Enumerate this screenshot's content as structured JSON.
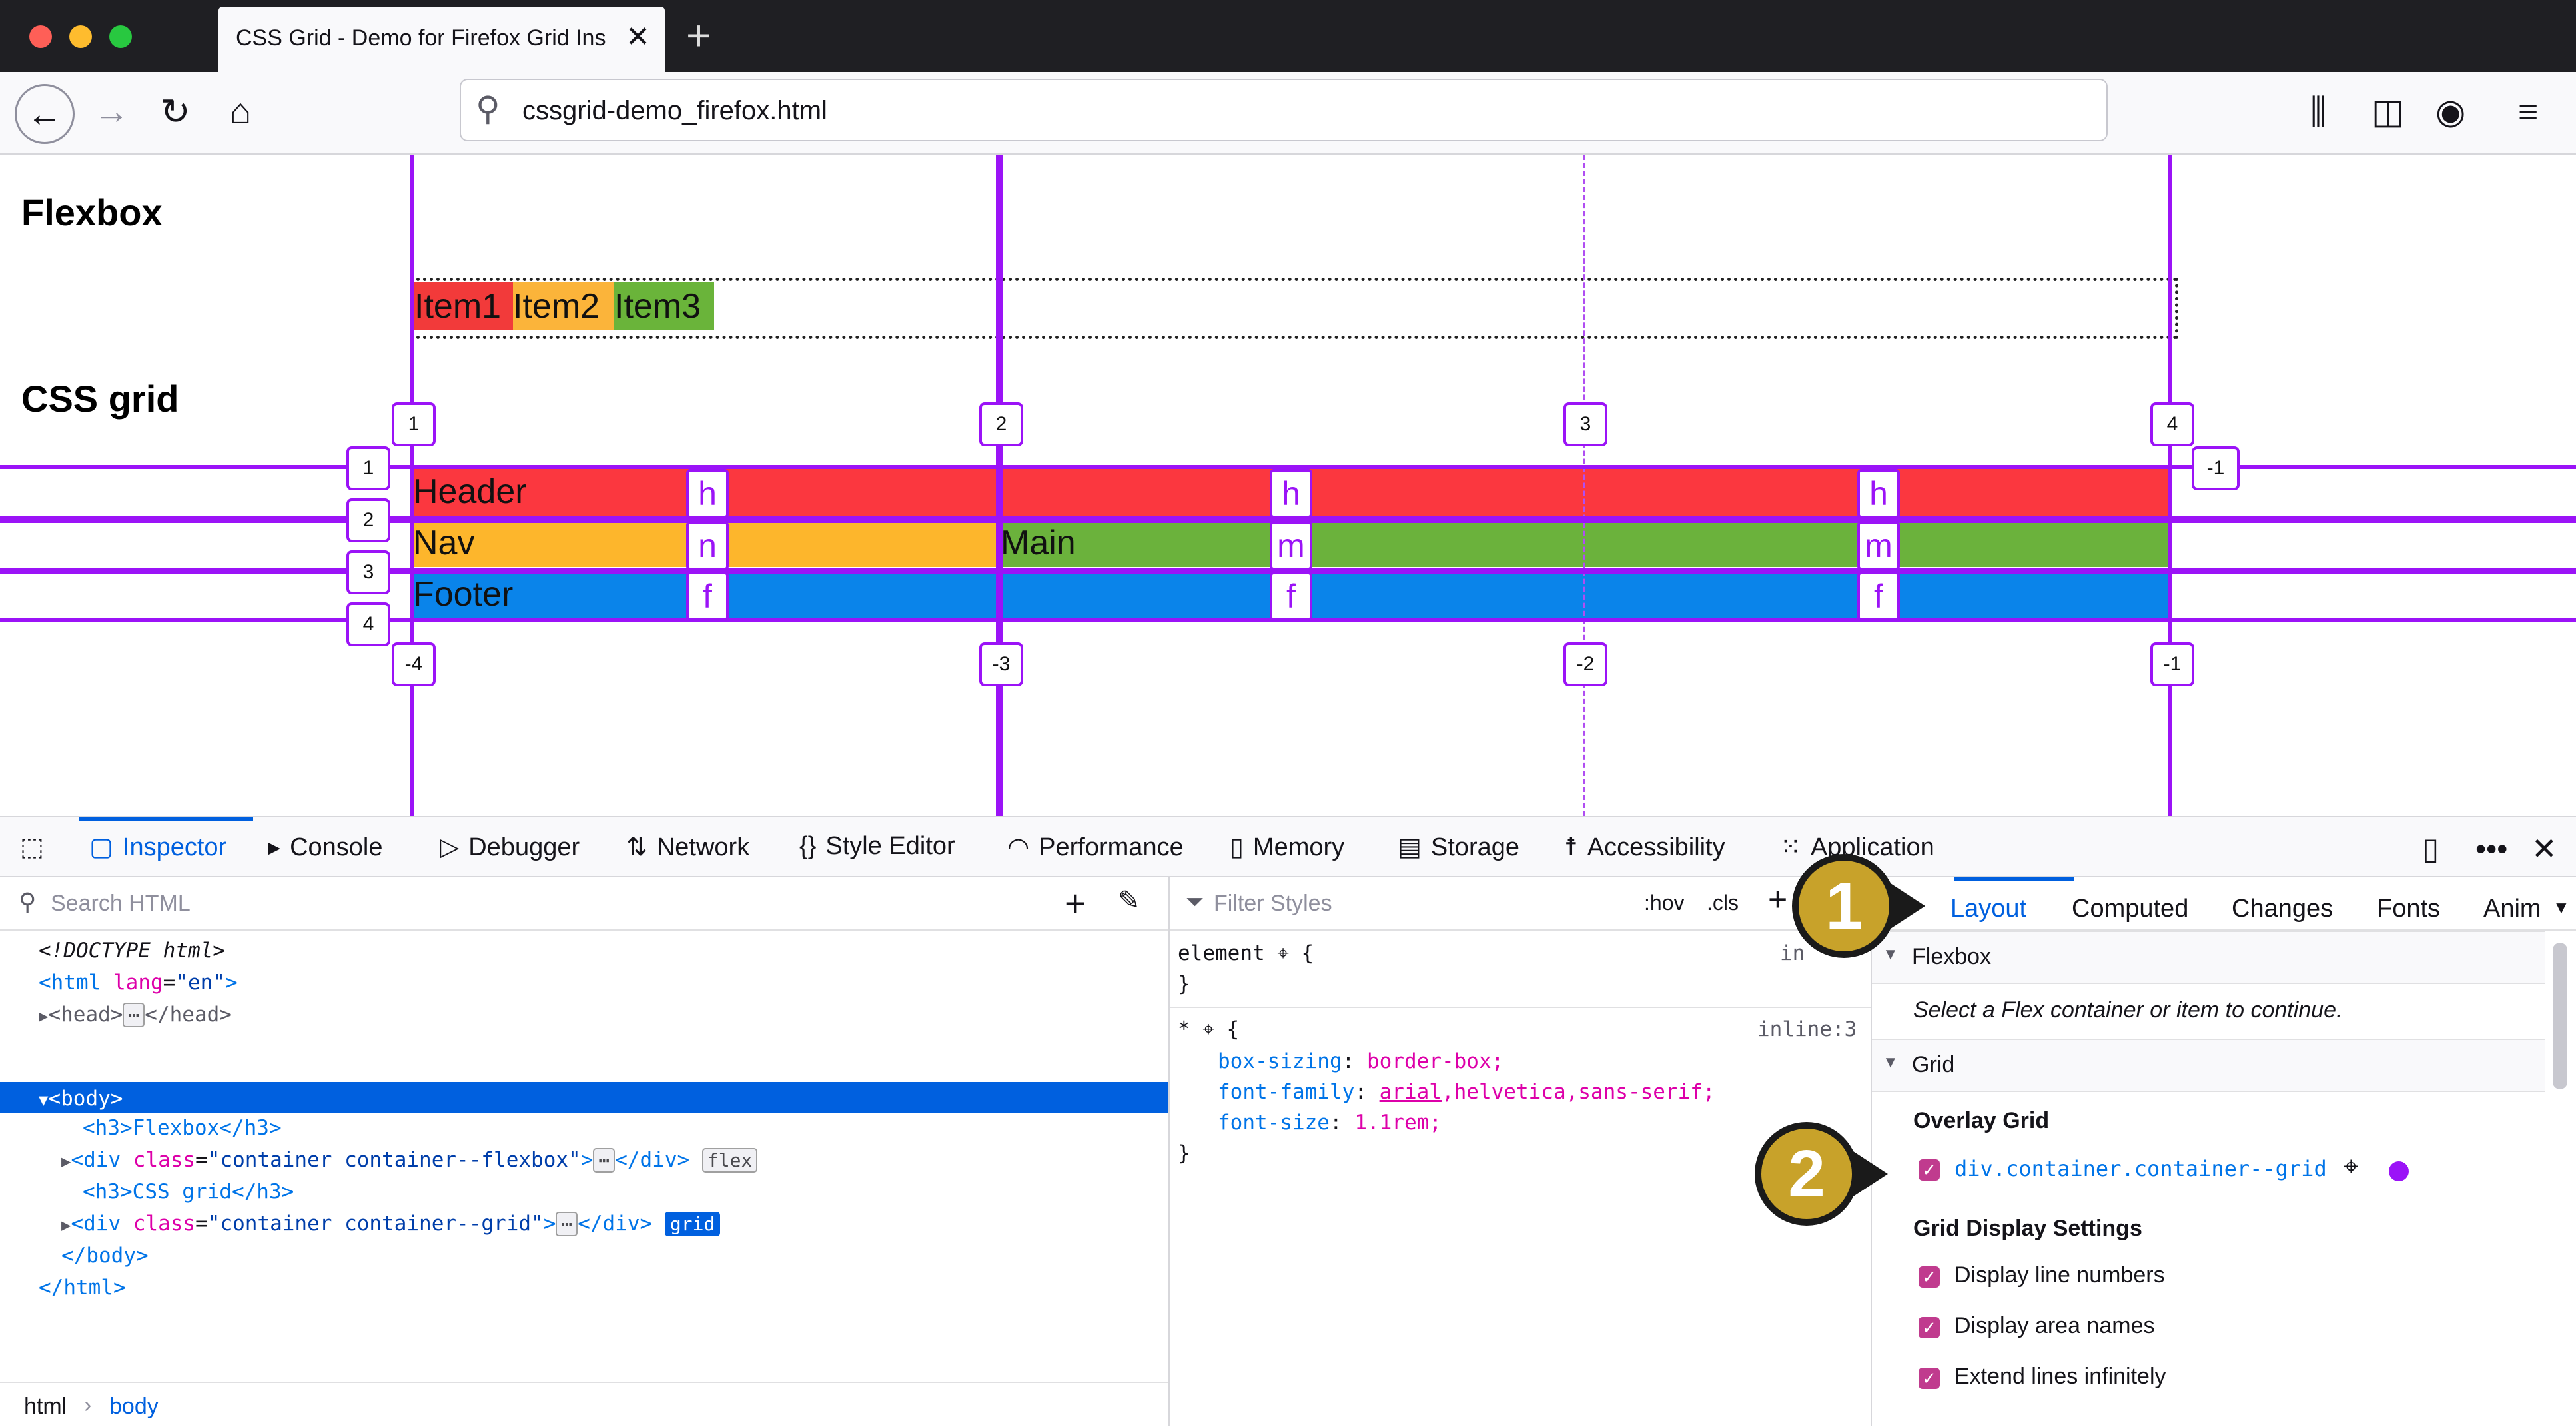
{
  "browser": {
    "tab_title": "CSS Grid - Demo for Firefox Grid Ins",
    "url": "cssgrid-demo_firefox.html"
  },
  "page": {
    "flexbox_heading": "Flexbox",
    "grid_heading": "CSS grid",
    "flex_items": [
      "Item1",
      "Item2",
      "Item3"
    ],
    "grid_cells": {
      "header": "Header",
      "nav": "Nav",
      "main": "Main",
      "footer": "Footer"
    },
    "area_labels": {
      "h": "h",
      "n": "n",
      "m": "m",
      "f": "f"
    },
    "column_lines_top": [
      "1",
      "2",
      "3",
      "4"
    ],
    "column_lines_bottom": [
      "-4",
      "-3",
      "-2",
      "-1"
    ],
    "row_lines": [
      "1",
      "2",
      "3",
      "4"
    ],
    "row_line_neg": "-1",
    "colors": {
      "overlay": "#9b13f7",
      "header": "#fb373f",
      "nav": "#fdb62c",
      "main": "#6bb23c",
      "footer": "#0a84ea",
      "item1": "#f23a3a",
      "item2": "#fbb43a",
      "item3": "#6ab43a"
    }
  },
  "devtools": {
    "tabs": [
      "Inspector",
      "Console",
      "Debugger",
      "Network",
      "Style Editor",
      "Performance",
      "Memory",
      "Storage",
      "Accessibility",
      "Application"
    ],
    "search_html_placeholder": "Search HTML",
    "filter_styles_placeholder": "Filter Styles",
    "hov": ":hov",
    "cls": ".cls",
    "markup": {
      "doctype": "<!DOCTYPE html>",
      "html_open_tag": "<html",
      "html_lang_attr": "lang",
      "html_lang_val": "\"en\"",
      "head": "<head>",
      "head_close": "</head>",
      "body_open": "<body>",
      "h3_flexbox": "<h3>Flexbox</h3>",
      "div_open": "<div",
      "class_attr": "class",
      "flex_class_val": "\"container container--flexbox\"",
      "grid_class_val": "\"container container--grid\"",
      "div_close": "</div>",
      "flex_badge": "flex",
      "grid_badge": "grid",
      "h3_grid": "<h3>CSS grid</h3>",
      "body_close": "</body>",
      "html_close": "</html>"
    },
    "breadcrumbs": [
      "html",
      "body"
    ],
    "rules": {
      "element_selector": "element",
      "inline_short": "in",
      "star_selector": "*",
      "star_source": "inline:3",
      "declarations": [
        {
          "prop": "box-sizing",
          "value": "border-box;"
        },
        {
          "prop": "font-family",
          "value_link": "arial",
          "value_rest": ",helvetica,sans-serif;"
        },
        {
          "prop": "font-size",
          "value": "1.1rem;"
        }
      ]
    },
    "layout": {
      "tabs": [
        "Layout",
        "Computed",
        "Changes",
        "Fonts",
        "Anim"
      ],
      "flexbox_section": "Flexbox",
      "flexbox_hint": "Select a Flex container or item to continue.",
      "grid_section": "Grid",
      "overlay_grid_title": "Overlay Grid",
      "overlay_item": "div.container.container--grid",
      "display_settings_title": "Grid Display Settings",
      "settings": [
        "Display line numbers",
        "Display area names",
        "Extend lines infinitely"
      ],
      "overlay_color": "#9b13f7",
      "checkbox_color": "#c03b8e"
    },
    "callouts": [
      "1",
      "2"
    ]
  }
}
